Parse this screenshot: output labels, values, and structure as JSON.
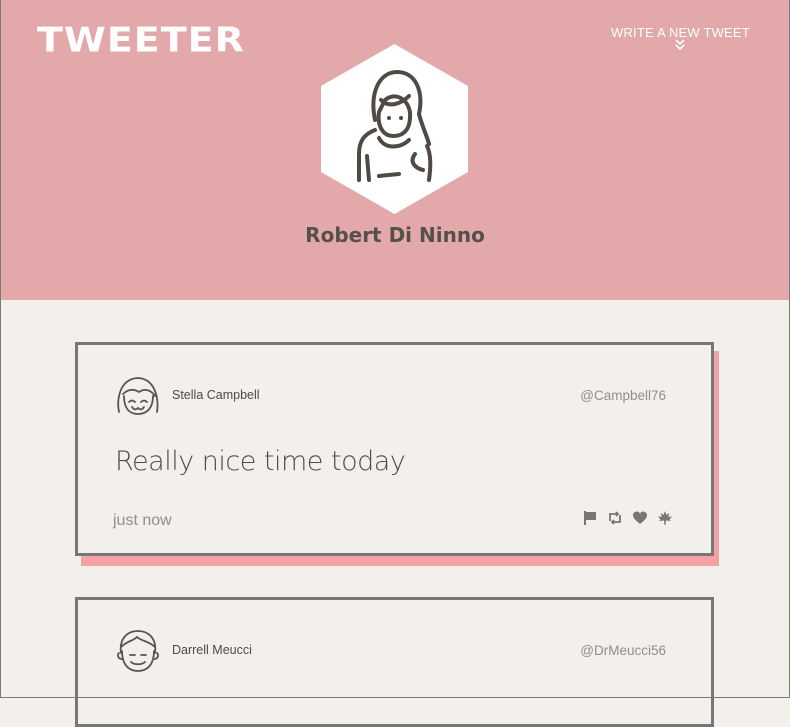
{
  "header": {
    "logo": "TWEETER",
    "write_link": "WRITE A NEW TWEET",
    "write_icon": "double-chevron-down-icon",
    "profile_name": "Robert Di Ninno",
    "background_color": "#e3a9aa"
  },
  "tweets": [
    {
      "author": "Stella Campbell",
      "handle": "@Campbell76",
      "content": "Really nice time today",
      "time": "just now",
      "actions": [
        "flag-icon",
        "retweet-icon",
        "heart-icon",
        "leaf-icon"
      ]
    },
    {
      "author": "Darrell Meucci",
      "handle": "@DrMeucci56"
    }
  ],
  "colors": {
    "page_bg": "#f3f0eb",
    "accent_shadow": "#f4a2a3",
    "border": "#777777"
  }
}
